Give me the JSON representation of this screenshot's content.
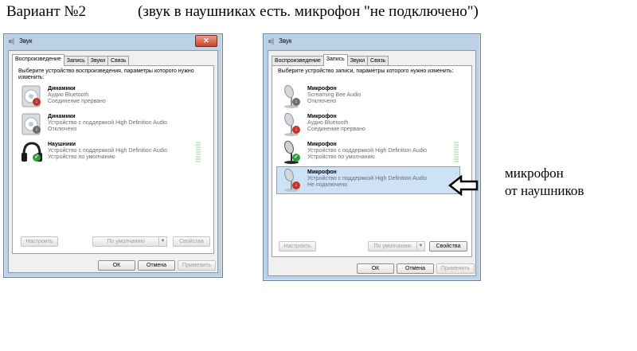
{
  "heading": {
    "variant": "Вариант №2",
    "note": "(звук в наушниках есть. микрофон \"не подключено\")"
  },
  "windows": [
    {
      "title": "Звук",
      "tabs": [
        "Воспроизведение",
        "Запись",
        "Звуки",
        "Связь"
      ],
      "active_tab": 0,
      "prompt": "Выберите устройство воспроизведения, параметры которого нужно изменить:",
      "devices": [
        {
          "name": "Динамики",
          "line1": "Аудио Bluetooth",
          "line2": "Соединение прервано",
          "icon": "speaker-icon",
          "badge": "red-disconnected-badge"
        },
        {
          "name": "Динамики",
          "line1": "Устройство с поддержкой High Definition Audio",
          "line2": "Отключено",
          "icon": "speaker-icon",
          "badge": "gray-disabled-badge"
        },
        {
          "name": "Наушники",
          "line1": "Устройство с поддержкой High Definition Audio",
          "line2": "Устройство по умолчанию",
          "icon": "headphones-icon",
          "badge": "green-check-badge"
        }
      ],
      "buttons": {
        "configure": "Настроить",
        "default": "По умолчанию",
        "properties": "Свойства",
        "ok": "ОК",
        "cancel": "Отмена",
        "apply": "Применить"
      }
    },
    {
      "title": "Звук",
      "tabs": [
        "Воспроизведение",
        "Запись",
        "Звуки",
        "Связь"
      ],
      "active_tab": 1,
      "prompt": "Выберите устройство записи, параметры которого нужно изменить:",
      "devices": [
        {
          "name": "Микрофон",
          "line1": "Screaming Bee Audio",
          "line2": "Отключено",
          "icon": "microphone-icon",
          "badge": "gray-disabled-badge"
        },
        {
          "name": "Микрофон",
          "line1": "Аудио Bluetooth",
          "line2": "Соединение прервано",
          "icon": "microphone-icon",
          "badge": "red-disconnected-badge"
        },
        {
          "name": "Микрофон",
          "line1": "Устройство с поддержкой High Definition Audio",
          "line2": "Устройство по умолчанию",
          "icon": "microphone-icon",
          "badge": "green-check-badge"
        },
        {
          "name": "Микрофон",
          "line1": "Устройство с поддержкой High Definition Audio",
          "line2": "Не подключено",
          "icon": "microphone-icon",
          "badge": "red-disconnected-badge",
          "selected": true
        }
      ],
      "buttons": {
        "configure": "Настроить",
        "default": "По умолчанию",
        "properties": "Свойства",
        "ok": "ОК",
        "cancel": "Отмена",
        "apply": "Применить"
      }
    }
  ],
  "callout": {
    "line1": "микрофон",
    "line2": "от наушников"
  },
  "colors": {
    "selection": "#cde1f7",
    "window_frame": "#bcd0e6",
    "status_gray": "#6d6d6d"
  }
}
